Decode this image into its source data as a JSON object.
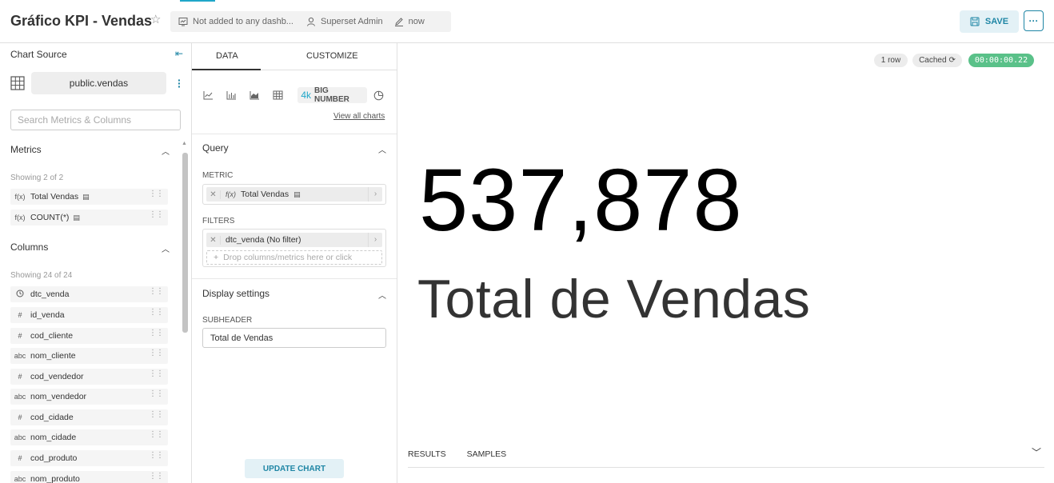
{
  "header": {
    "title": "Gráfico KPI - Vendas",
    "dashboards": "Not added to any dashb...",
    "owner": "Superset Admin",
    "modified": "now",
    "save_label": "SAVE",
    "more_label": "···"
  },
  "datasource": {
    "header": "Chart Source",
    "name": "public.vendas",
    "search_placeholder": "Search Metrics & Columns"
  },
  "metrics": {
    "title": "Metrics",
    "showing": "Showing 2 of 2",
    "items": [
      {
        "type": "f(x)",
        "label": "Total Vendas"
      },
      {
        "type": "f(x)",
        "label": "COUNT(*)"
      }
    ]
  },
  "columns": {
    "title": "Columns",
    "showing": "Showing 24 of 24",
    "items": [
      {
        "type": "clock",
        "label": "dtc_venda"
      },
      {
        "type": "#",
        "label": "id_venda"
      },
      {
        "type": "#",
        "label": "cod_cliente"
      },
      {
        "type": "abc",
        "label": "nom_cliente"
      },
      {
        "type": "#",
        "label": "cod_vendedor"
      },
      {
        "type": "abc",
        "label": "nom_vendedor"
      },
      {
        "type": "#",
        "label": "cod_cidade"
      },
      {
        "type": "abc",
        "label": "nom_cidade"
      },
      {
        "type": "#",
        "label": "cod_produto"
      },
      {
        "type": "abc",
        "label": "nom_produto"
      }
    ]
  },
  "control_panel": {
    "tab_data": "DATA",
    "tab_customize": "CUSTOMIZE",
    "big_number_icon": "4k",
    "big_number_label": "BIG NUMBER",
    "view_all": "View all charts",
    "query_title": "Query",
    "metric_label": "METRIC",
    "metric_value": "Total Vendas",
    "filters_label": "FILTERS",
    "filter_value": "dtc_venda (No filter)",
    "drop_placeholder": "Drop columns/metrics here or click",
    "display_title": "Display settings",
    "subheader_label": "SUBHEADER",
    "subheader_value": "Total de Vendas",
    "update_label": "UPDATE CHART"
  },
  "result": {
    "rows_badge": "1 row",
    "cached_badge": "Cached",
    "timer": "00:00:00.22",
    "big_number": "537,878",
    "subheader": "Total de Vendas",
    "tab_results": "RESULTS",
    "tab_samples": "SAMPLES"
  },
  "colors": {
    "accent": "#1f86a5",
    "timer_bg": "#5ac189"
  }
}
